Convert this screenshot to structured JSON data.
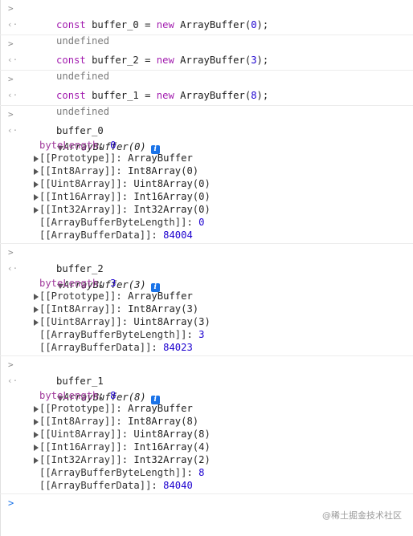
{
  "console": {
    "commands": [
      {
        "kw_const": "const",
        "name": "buffer_0",
        "eq": " = ",
        "kw_new": "new",
        "cls": "ArrayBuffer",
        "open": "(",
        "arg": "0",
        "close": ");",
        "result": "undefined"
      },
      {
        "kw_const": "const",
        "name": "buffer_2",
        "eq": " = ",
        "kw_new": "new",
        "cls": "ArrayBuffer",
        "open": "(",
        "arg": "3",
        "close": ");",
        "result": "undefined"
      },
      {
        "kw_const": "const",
        "name": "buffer_1",
        "eq": " = ",
        "kw_new": "new",
        "cls": "ArrayBuffer",
        "open": "(",
        "arg": "8",
        "close": ");",
        "result": "undefined"
      }
    ],
    "inspections": [
      {
        "input": "buffer_0",
        "header": "ArrayBuffer(0)",
        "byteLength_key": "byteLength",
        "byteLength_val": "0",
        "props": [
          {
            "key": "[[Prototype]]",
            "val": "ArrayBuffer"
          },
          {
            "key": "[[Int8Array]]",
            "val": "Int8Array(0)"
          },
          {
            "key": "[[Uint8Array]]",
            "val": "Uint8Array(0)"
          },
          {
            "key": "[[Int16Array]]",
            "val": "Int16Array(0)"
          },
          {
            "key": "[[Int32Array]]",
            "val": "Int32Array(0)"
          }
        ],
        "byteLen_key": "[[ArrayBufferByteLength]]",
        "byteLen_val": "0",
        "data_key": "[[ArrayBufferData]]",
        "data_val": "84004"
      },
      {
        "input": "buffer_2",
        "header": "ArrayBuffer(3)",
        "byteLength_key": "byteLength",
        "byteLength_val": "3",
        "props": [
          {
            "key": "[[Prototype]]",
            "val": "ArrayBuffer"
          },
          {
            "key": "[[Int8Array]]",
            "val": "Int8Array(3)"
          },
          {
            "key": "[[Uint8Array]]",
            "val": "Uint8Array(3)"
          }
        ],
        "byteLen_key": "[[ArrayBufferByteLength]]",
        "byteLen_val": "3",
        "data_key": "[[ArrayBufferData]]",
        "data_val": "84023"
      },
      {
        "input": "buffer_1",
        "header": "ArrayBuffer(8)",
        "byteLength_key": "byteLength",
        "byteLength_val": "8",
        "props": [
          {
            "key": "[[Prototype]]",
            "val": "ArrayBuffer"
          },
          {
            "key": "[[Int8Array]]",
            "val": "Int8Array(8)"
          },
          {
            "key": "[[Uint8Array]]",
            "val": "Uint8Array(8)"
          },
          {
            "key": "[[Int16Array]]",
            "val": "Int16Array(4)"
          },
          {
            "key": "[[Int32Array]]",
            "val": "Int32Array(2)"
          }
        ],
        "byteLen_key": "[[ArrayBufferByteLength]]",
        "byteLen_val": "8",
        "data_key": "[[ArrayBufferData]]",
        "data_val": "84040"
      }
    ],
    "colon": ": ",
    "info_glyph": "i",
    "prompt_glyph": ">",
    "return_glyph": "‹·",
    "input_prompt_glyph": ">"
  },
  "watermark": "@稀土掘金技术社区",
  "colors": {
    "keyword": "#a21caf",
    "number": "#1c00cf",
    "own_key": "#a03a9c",
    "info": "#1a73e8"
  }
}
